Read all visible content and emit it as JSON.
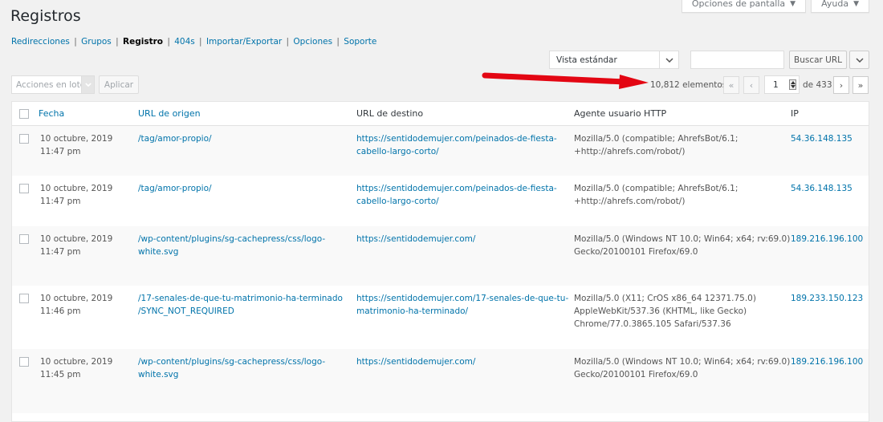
{
  "page": {
    "title": "Registros"
  },
  "screen_tabs": [
    {
      "label": "Opciones de pantalla"
    },
    {
      "label": "Ayuda"
    }
  ],
  "subnav": [
    {
      "label": "Redirecciones",
      "current": false
    },
    {
      "label": "Grupos",
      "current": false
    },
    {
      "label": "Registro",
      "current": true
    },
    {
      "label": "404s",
      "current": false
    },
    {
      "label": "Importar/Exportar",
      "current": false
    },
    {
      "label": "Opciones",
      "current": false
    },
    {
      "label": "Soporte",
      "current": false
    }
  ],
  "toolbar": {
    "view_select": "Vista estándar",
    "search_value": "",
    "search_button": "Buscar URL",
    "bulk_actions": "Acciones en lote",
    "apply_button": "Aplicar"
  },
  "pagination": {
    "items_count": "10,812 elementos",
    "current_page": "1",
    "of_pages": "de 433",
    "first": "«",
    "prev": "‹",
    "next": "›",
    "last": "»"
  },
  "table": {
    "headers": {
      "date": "Fecha",
      "source": "URL de origen",
      "target": "URL de destino",
      "agent": "Agente usuario HTTP",
      "ip": "IP"
    },
    "rows": [
      {
        "date": "10 octubre, 2019",
        "time": "11:47 pm",
        "source": [
          "/tag/amor-propio/"
        ],
        "target": [
          "https://sentidodemujer.com/peinados-de-fiesta-",
          "cabello-largo-corto/"
        ],
        "agent": [
          "Mozilla/5.0 (compatible; AhrefsBot/6.1;",
          "+http://ahrefs.com/robot/)"
        ],
        "ip": "54.36.148.135"
      },
      {
        "date": "10 octubre, 2019",
        "time": "11:47 pm",
        "source": [
          "/tag/amor-propio/"
        ],
        "target": [
          "https://sentidodemujer.com/peinados-de-fiesta-",
          "cabello-largo-corto/"
        ],
        "agent": [
          "Mozilla/5.0 (compatible; AhrefsBot/6.1;",
          "+http://ahrefs.com/robot/)"
        ],
        "ip": "54.36.148.135"
      },
      {
        "date": "10 octubre, 2019",
        "time": "11:47 pm",
        "source": [
          "/wp-content/plugins/sg-cachepress/css/logo-",
          "white.svg"
        ],
        "target": [
          "https://sentidodemujer.com/"
        ],
        "agent": [
          "Mozilla/5.0 (Windows NT 10.0; Win64; x64; rv:69.0)",
          "Gecko/20100101 Firefox/69.0"
        ],
        "ip": "189.216.196.100"
      },
      {
        "date": "10 octubre, 2019",
        "time": "11:46 pm",
        "source": [
          "/17-senales-de-que-tu-matrimonio-ha-terminado",
          "/SYNC_NOT_REQUIRED"
        ],
        "target": [
          "https://sentidodemujer.com/17-senales-de-que-tu-",
          "matrimonio-ha-terminado/"
        ],
        "agent": [
          "Mozilla/5.0 (X11; CrOS x86_64 12371.75.0)",
          "AppleWebKit/537.36 (KHTML, like Gecko)",
          "Chrome/77.0.3865.105 Safari/537.36"
        ],
        "ip": "189.233.150.123"
      },
      {
        "date": "10 octubre, 2019",
        "time": "11:45 pm",
        "source": [
          "/wp-content/plugins/sg-cachepress/css/logo-",
          "white.svg"
        ],
        "target": [
          "https://sentidodemujer.com/"
        ],
        "agent": [
          "Mozilla/5.0 (Windows NT 10.0; Win64; x64; rv:69.0)",
          "Gecko/20100101 Firefox/69.0"
        ],
        "ip": "189.216.196.100"
      }
    ]
  },
  "colors": {
    "link": "#0073aa",
    "annotation_arrow": "#e30613",
    "background": "#f1f1f1"
  }
}
